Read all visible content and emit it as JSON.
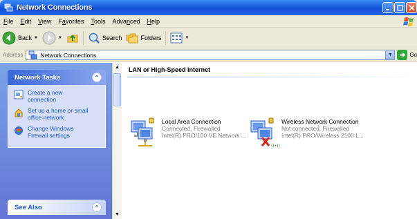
{
  "window": {
    "title": "Network Connections"
  },
  "menu": [
    {
      "label": "File",
      "accel": "F",
      "rest": "ile"
    },
    {
      "label": "Edit",
      "accel": "E",
      "rest": "dit"
    },
    {
      "label": "View",
      "accel": "V",
      "rest": "iew"
    },
    {
      "label": "Favorites",
      "pre": "F",
      "accel": "a",
      "rest": "vorites"
    },
    {
      "label": "Tools",
      "accel": "T",
      "rest": "ools"
    },
    {
      "label": "Advanced",
      "pre": "Adva",
      "accel": "n",
      "rest": "ced"
    },
    {
      "label": "Help",
      "accel": "H",
      "rest": "elp"
    }
  ],
  "toolbar": {
    "back_label": "Back",
    "search_label": "Search",
    "folders_label": "Folders"
  },
  "address": {
    "label": "Address",
    "value": "Network Connections",
    "go_label": "Go"
  },
  "taskpane": {
    "network_tasks": {
      "title": "Network Tasks",
      "items": [
        {
          "label": "Create a new\nconnection",
          "icon": "new-connection-icon"
        },
        {
          "label": "Set up a home or small\noffice network",
          "icon": "home-network-icon"
        },
        {
          "label": "Change Windows\nFirewall settings",
          "icon": "firewall-icon"
        }
      ]
    },
    "see_also": {
      "title": "See Also"
    }
  },
  "main": {
    "group_title": "LAN or High-Speed Internet",
    "connections": [
      {
        "name": "Local Area Connection",
        "status": "Connected, Firewalled",
        "device": "Intel(R) PRO/100 VE Network ...",
        "icon": "lan-connection-icon"
      },
      {
        "name": "Wireless Network Connection",
        "status": "Not connected, Firewalled",
        "device": "Intel(R) PRO/Wireless 2100 L...",
        "icon": "wireless-connection-icon"
      }
    ]
  },
  "colors": {
    "titlebar": "#1b5fe0",
    "chrome": "#ece9d8",
    "taskpane": "#6f8cdf",
    "link": "#215dc6"
  }
}
